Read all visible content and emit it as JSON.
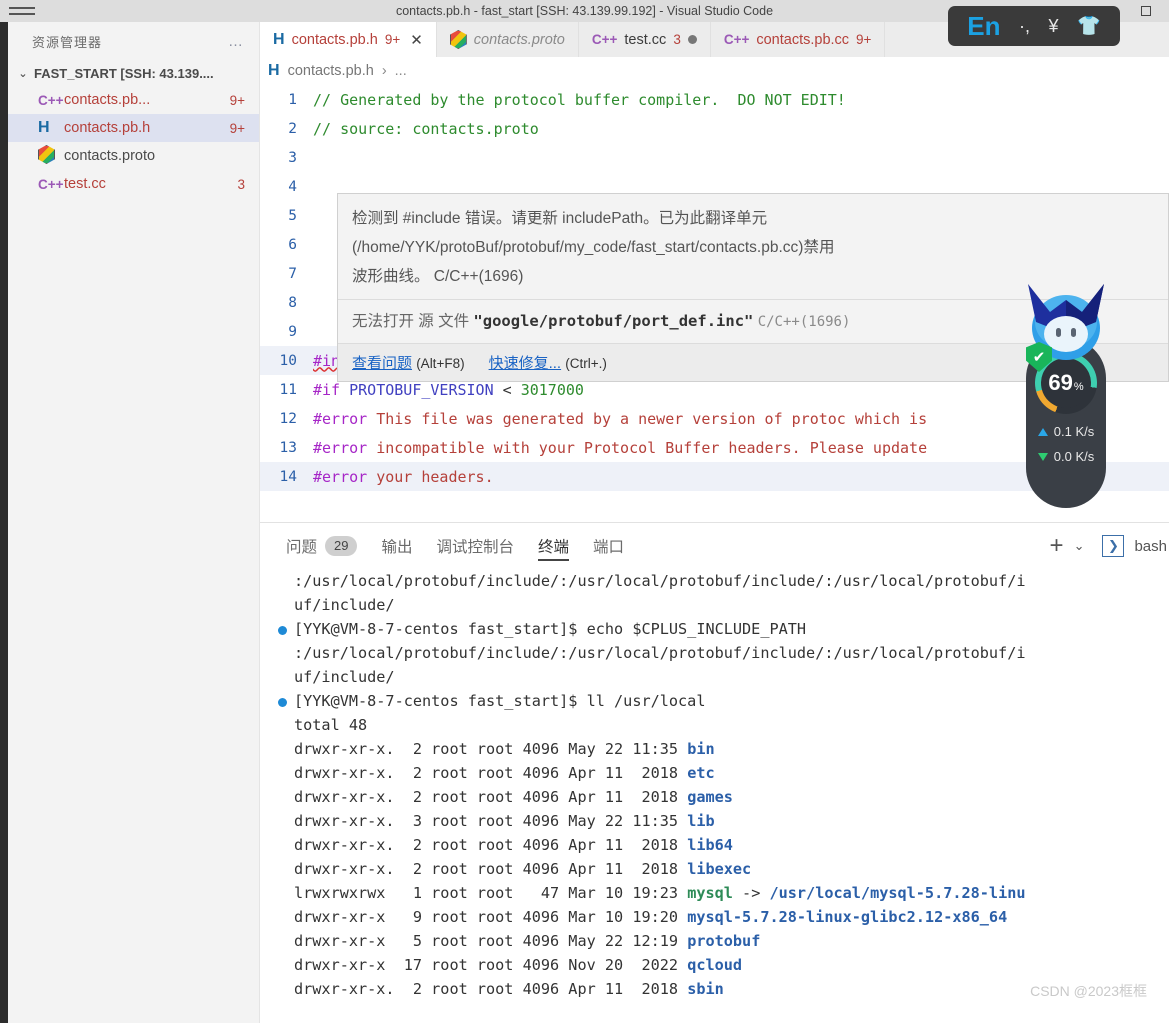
{
  "window": {
    "title": "contacts.pb.h - fast_start [SSH: 43.139.99.192] - Visual Studio Code",
    "menu_icon": "hamburger-menu-icon"
  },
  "sidebar": {
    "title": "资源管理器",
    "more_actions": "…",
    "root_label": "FAST_START [SSH: 43.139....",
    "files": [
      {
        "icon": "cpp",
        "name": "contacts.pb...",
        "badge": "9+",
        "selected": false,
        "error": true
      },
      {
        "icon": "h",
        "name": "contacts.pb.h",
        "badge": "9+",
        "selected": true,
        "error": true
      },
      {
        "icon": "proto",
        "name": "contacts.proto",
        "badge": "",
        "selected": false,
        "error": false
      },
      {
        "icon": "cpp",
        "name": "test.cc",
        "badge": "3",
        "selected": false,
        "error": true
      }
    ]
  },
  "tabs": [
    {
      "icon": "h",
      "label": "contacts.pb.h",
      "badge": "9+",
      "active": true,
      "close": "✕",
      "style": "err"
    },
    {
      "icon": "proto",
      "label": "contacts.proto",
      "badge": "",
      "active": false,
      "close": "",
      "style": "muted"
    },
    {
      "icon": "cpp",
      "label": "test.cc",
      "badge": "3",
      "active": false,
      "close": "",
      "style": "dark",
      "dirty": true
    },
    {
      "icon": "cpp",
      "label": "contacts.pb.cc",
      "badge": "9+",
      "active": false,
      "close": "",
      "style": "err"
    }
  ],
  "breadcrumb": {
    "icon": "h",
    "file": "contacts.pb.h",
    "separator": "›",
    "more": "..."
  },
  "code": {
    "lines": [
      {
        "num": "1",
        "segments": [
          {
            "t": "// Generated by the protocol buffer compiler.  DO NOT EDIT!",
            "c": "c-comment"
          }
        ]
      },
      {
        "num": "2",
        "segments": [
          {
            "t": "// source: contacts.proto",
            "c": "c-comment"
          }
        ]
      },
      {
        "num": "3",
        "segments": []
      },
      {
        "num": "4",
        "segments": []
      },
      {
        "num": "5",
        "segments": []
      },
      {
        "num": "6",
        "segments": []
      },
      {
        "num": "7",
        "segments": []
      },
      {
        "num": "8",
        "segments": []
      },
      {
        "num": "9",
        "segments": []
      },
      {
        "num": "10",
        "segments": [
          {
            "t": "#include",
            "c": "c-dir"
          },
          {
            "t": " ",
            "c": "c-plain"
          },
          {
            "t": "<google/protobuf/port_def.inc>",
            "c": "c-str"
          }
        ],
        "wavy": true,
        "hl": true
      },
      {
        "num": "11",
        "segments": [
          {
            "t": "#if",
            "c": "c-dir"
          },
          {
            "t": " ",
            "c": "c-plain"
          },
          {
            "t": "PROTOBUF_VERSION",
            "c": "c-id"
          },
          {
            "t": " < ",
            "c": "c-plain"
          },
          {
            "t": "3017000",
            "c": "c-num"
          }
        ]
      },
      {
        "num": "12",
        "segments": [
          {
            "t": "#error",
            "c": "c-dir"
          },
          {
            "t": " This file was generated by a newer version of protoc which is",
            "c": "c-str"
          }
        ]
      },
      {
        "num": "13",
        "segments": [
          {
            "t": "#error",
            "c": "c-dir"
          },
          {
            "t": " incompatible with your Protocol Buffer headers. Please update",
            "c": "c-str"
          }
        ]
      },
      {
        "num": "14",
        "segments": [
          {
            "t": "#error",
            "c": "c-dir"
          },
          {
            "t": " your headers.",
            "c": "c-str"
          }
        ],
        "hl": true
      }
    ]
  },
  "hover": {
    "message_line1": "检测到 #include 错误。请更新 includePath。已为此翻译单元",
    "message_line2": "(/home/YYK/protoBuf/protobuf/my_code/fast_start/contacts.pb.cc)禁用",
    "message_line3": "波形曲线。 C/C++(1696)",
    "second_prefix": "无法打开 源 文件 ",
    "second_file": "\"google/protobuf/port_def.inc\"",
    "second_code": "C/C++(1696)",
    "action_problem": "查看问题",
    "action_problem_key": "(Alt+F8)",
    "action_fix": "快速修复...",
    "action_fix_key": "(Ctrl+.)"
  },
  "panel": {
    "tabs": [
      {
        "label": "问题",
        "count": "29",
        "active": false
      },
      {
        "label": "输出",
        "count": "",
        "active": false
      },
      {
        "label": "调试控制台",
        "count": "",
        "active": false
      },
      {
        "label": "终端",
        "count": "",
        "active": true
      },
      {
        "label": "端口",
        "count": "",
        "active": false
      }
    ],
    "add_icon": "plus-icon",
    "chevron_icon": "chevron-down-icon",
    "shell_icon": "terminal-chevron-icon",
    "shell_label": "bash"
  },
  "terminal": {
    "lines": [
      {
        "kind": "out",
        "segments": [
          {
            "t": ":/usr/local/protobuf/include/:/usr/local/protobuf/include/:/usr/local/protobuf/i",
            "c": ""
          }
        ]
      },
      {
        "kind": "out",
        "segments": [
          {
            "t": "uf/include/",
            "c": ""
          }
        ]
      },
      {
        "kind": "cmd",
        "segments": [
          {
            "t": "[YYK@VM-8-7-centos fast_start]$ echo $CPLUS_INCLUDE_PATH",
            "c": ""
          }
        ]
      },
      {
        "kind": "out",
        "segments": [
          {
            "t": ":/usr/local/protobuf/include/:/usr/local/protobuf/include/:/usr/local/protobuf/i",
            "c": ""
          }
        ]
      },
      {
        "kind": "out",
        "segments": [
          {
            "t": "uf/include/",
            "c": ""
          }
        ]
      },
      {
        "kind": "cmd",
        "segments": [
          {
            "t": "[YYK@VM-8-7-centos fast_start]$ ll /usr/local",
            "c": ""
          }
        ]
      },
      {
        "kind": "out",
        "segments": [
          {
            "t": "total 48",
            "c": ""
          }
        ]
      },
      {
        "kind": "out",
        "segments": [
          {
            "t": "drwxr-xr-x.  2 root root 4096 May 22 11:35 ",
            "c": ""
          },
          {
            "t": "bin",
            "c": "t-dir"
          }
        ]
      },
      {
        "kind": "out",
        "segments": [
          {
            "t": "drwxr-xr-x.  2 root root 4096 Apr 11  2018 ",
            "c": ""
          },
          {
            "t": "etc",
            "c": "t-dir"
          }
        ]
      },
      {
        "kind": "out",
        "segments": [
          {
            "t": "drwxr-xr-x.  2 root root 4096 Apr 11  2018 ",
            "c": ""
          },
          {
            "t": "games",
            "c": "t-dir"
          }
        ]
      },
      {
        "kind": "out",
        "segments": [
          {
            "t": "drwxr-xr-x.  3 root root 4096 May 22 11:35 ",
            "c": ""
          },
          {
            "t": "lib",
            "c": "t-dir"
          }
        ]
      },
      {
        "kind": "out",
        "segments": [
          {
            "t": "drwxr-xr-x.  2 root root 4096 Apr 11  2018 ",
            "c": ""
          },
          {
            "t": "lib64",
            "c": "t-dir"
          }
        ]
      },
      {
        "kind": "out",
        "segments": [
          {
            "t": "drwxr-xr-x.  2 root root 4096 Apr 11  2018 ",
            "c": ""
          },
          {
            "t": "libexec",
            "c": "t-dir"
          }
        ]
      },
      {
        "kind": "out",
        "segments": [
          {
            "t": "lrwxrwxrwx   1 root root   47 Mar 10 19:23 ",
            "c": ""
          },
          {
            "t": "mysql",
            "c": "t-link"
          },
          {
            "t": " -> ",
            "c": ""
          },
          {
            "t": "/usr/local/mysql-5.7.28-linu",
            "c": "t-target"
          }
        ]
      },
      {
        "kind": "out",
        "segments": [
          {
            "t": "drwxr-xr-x   9 root root 4096 Mar 10 19:20 ",
            "c": ""
          },
          {
            "t": "mysql-5.7.28-linux-glibc2.12-x86_64",
            "c": "t-dir"
          }
        ]
      },
      {
        "kind": "out",
        "segments": [
          {
            "t": "drwxr-xr-x   5 root root 4096 May 22 12:19 ",
            "c": ""
          },
          {
            "t": "protobuf",
            "c": "t-dir"
          }
        ]
      },
      {
        "kind": "out",
        "segments": [
          {
            "t": "drwxr-xr-x  17 root root 4096 Nov 20  2022 ",
            "c": ""
          },
          {
            "t": "qcloud",
            "c": "t-dir"
          }
        ]
      },
      {
        "kind": "out",
        "segments": [
          {
            "t": "drwxr-xr-x.  2 root root 4096 Apr 11  2018 ",
            "c": ""
          },
          {
            "t": "sbin",
            "c": "t-dir"
          }
        ]
      }
    ]
  },
  "overlays": {
    "ime": {
      "lang": "En",
      "glyph1": "·,",
      "glyph2": "¥",
      "shirt": "shirt-icon"
    },
    "netmon": {
      "cpu_percent": "69",
      "percent_symbol": "%",
      "upload": "0.1 K/s",
      "download": "0.0 K/s",
      "shield_check": "✔"
    }
  },
  "watermark": "CSDN @2023框框",
  "colors": {
    "accent": "#1a6aa3",
    "error": "#b5403a",
    "comment": "#2e8b2e",
    "directive": "#a626c7",
    "terminal_dir": "#2b5fa8"
  }
}
